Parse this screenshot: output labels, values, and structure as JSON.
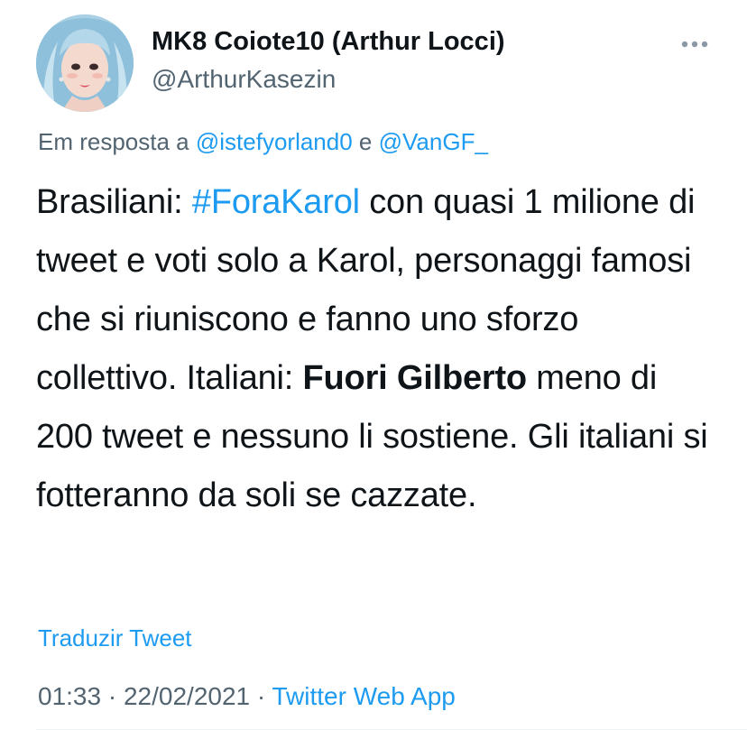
{
  "author": {
    "display_name": "MK8 Coiote10 (Arthur Locci)",
    "handle": "@ArthurKasezin",
    "avatar_icon": "profile-photo"
  },
  "menu": {
    "icon": "more-horizontal-icon"
  },
  "reply": {
    "prefix": "Em resposta a",
    "mention_1": "@istefyorland0",
    "conjunction": "e",
    "mention_2": "@VanGF_"
  },
  "tweet": {
    "text_part_1": "Brasiliani: ",
    "hashtag": "#ForaKarol",
    "text_part_2": " con quasi 1 milione di tweet e voti solo a Karol, personaggi famosi che si riuniscono e fanno uno sforzo collettivo. Italiani: ",
    "bold_text": "Fuori Gilberto",
    "text_part_3": " meno di 200 tweet e nessuno li sostiene. Gli italiani si fotteranno da soli se cazzate."
  },
  "translate_label": "Traduzir Tweet",
  "meta": {
    "time": "01:33",
    "separator": " · ",
    "date": "22/02/2021",
    "source": "Twitter Web App"
  },
  "colors": {
    "link": "#1d9bf0",
    "secondary_text": "#536471",
    "primary_text": "#0f1419"
  }
}
